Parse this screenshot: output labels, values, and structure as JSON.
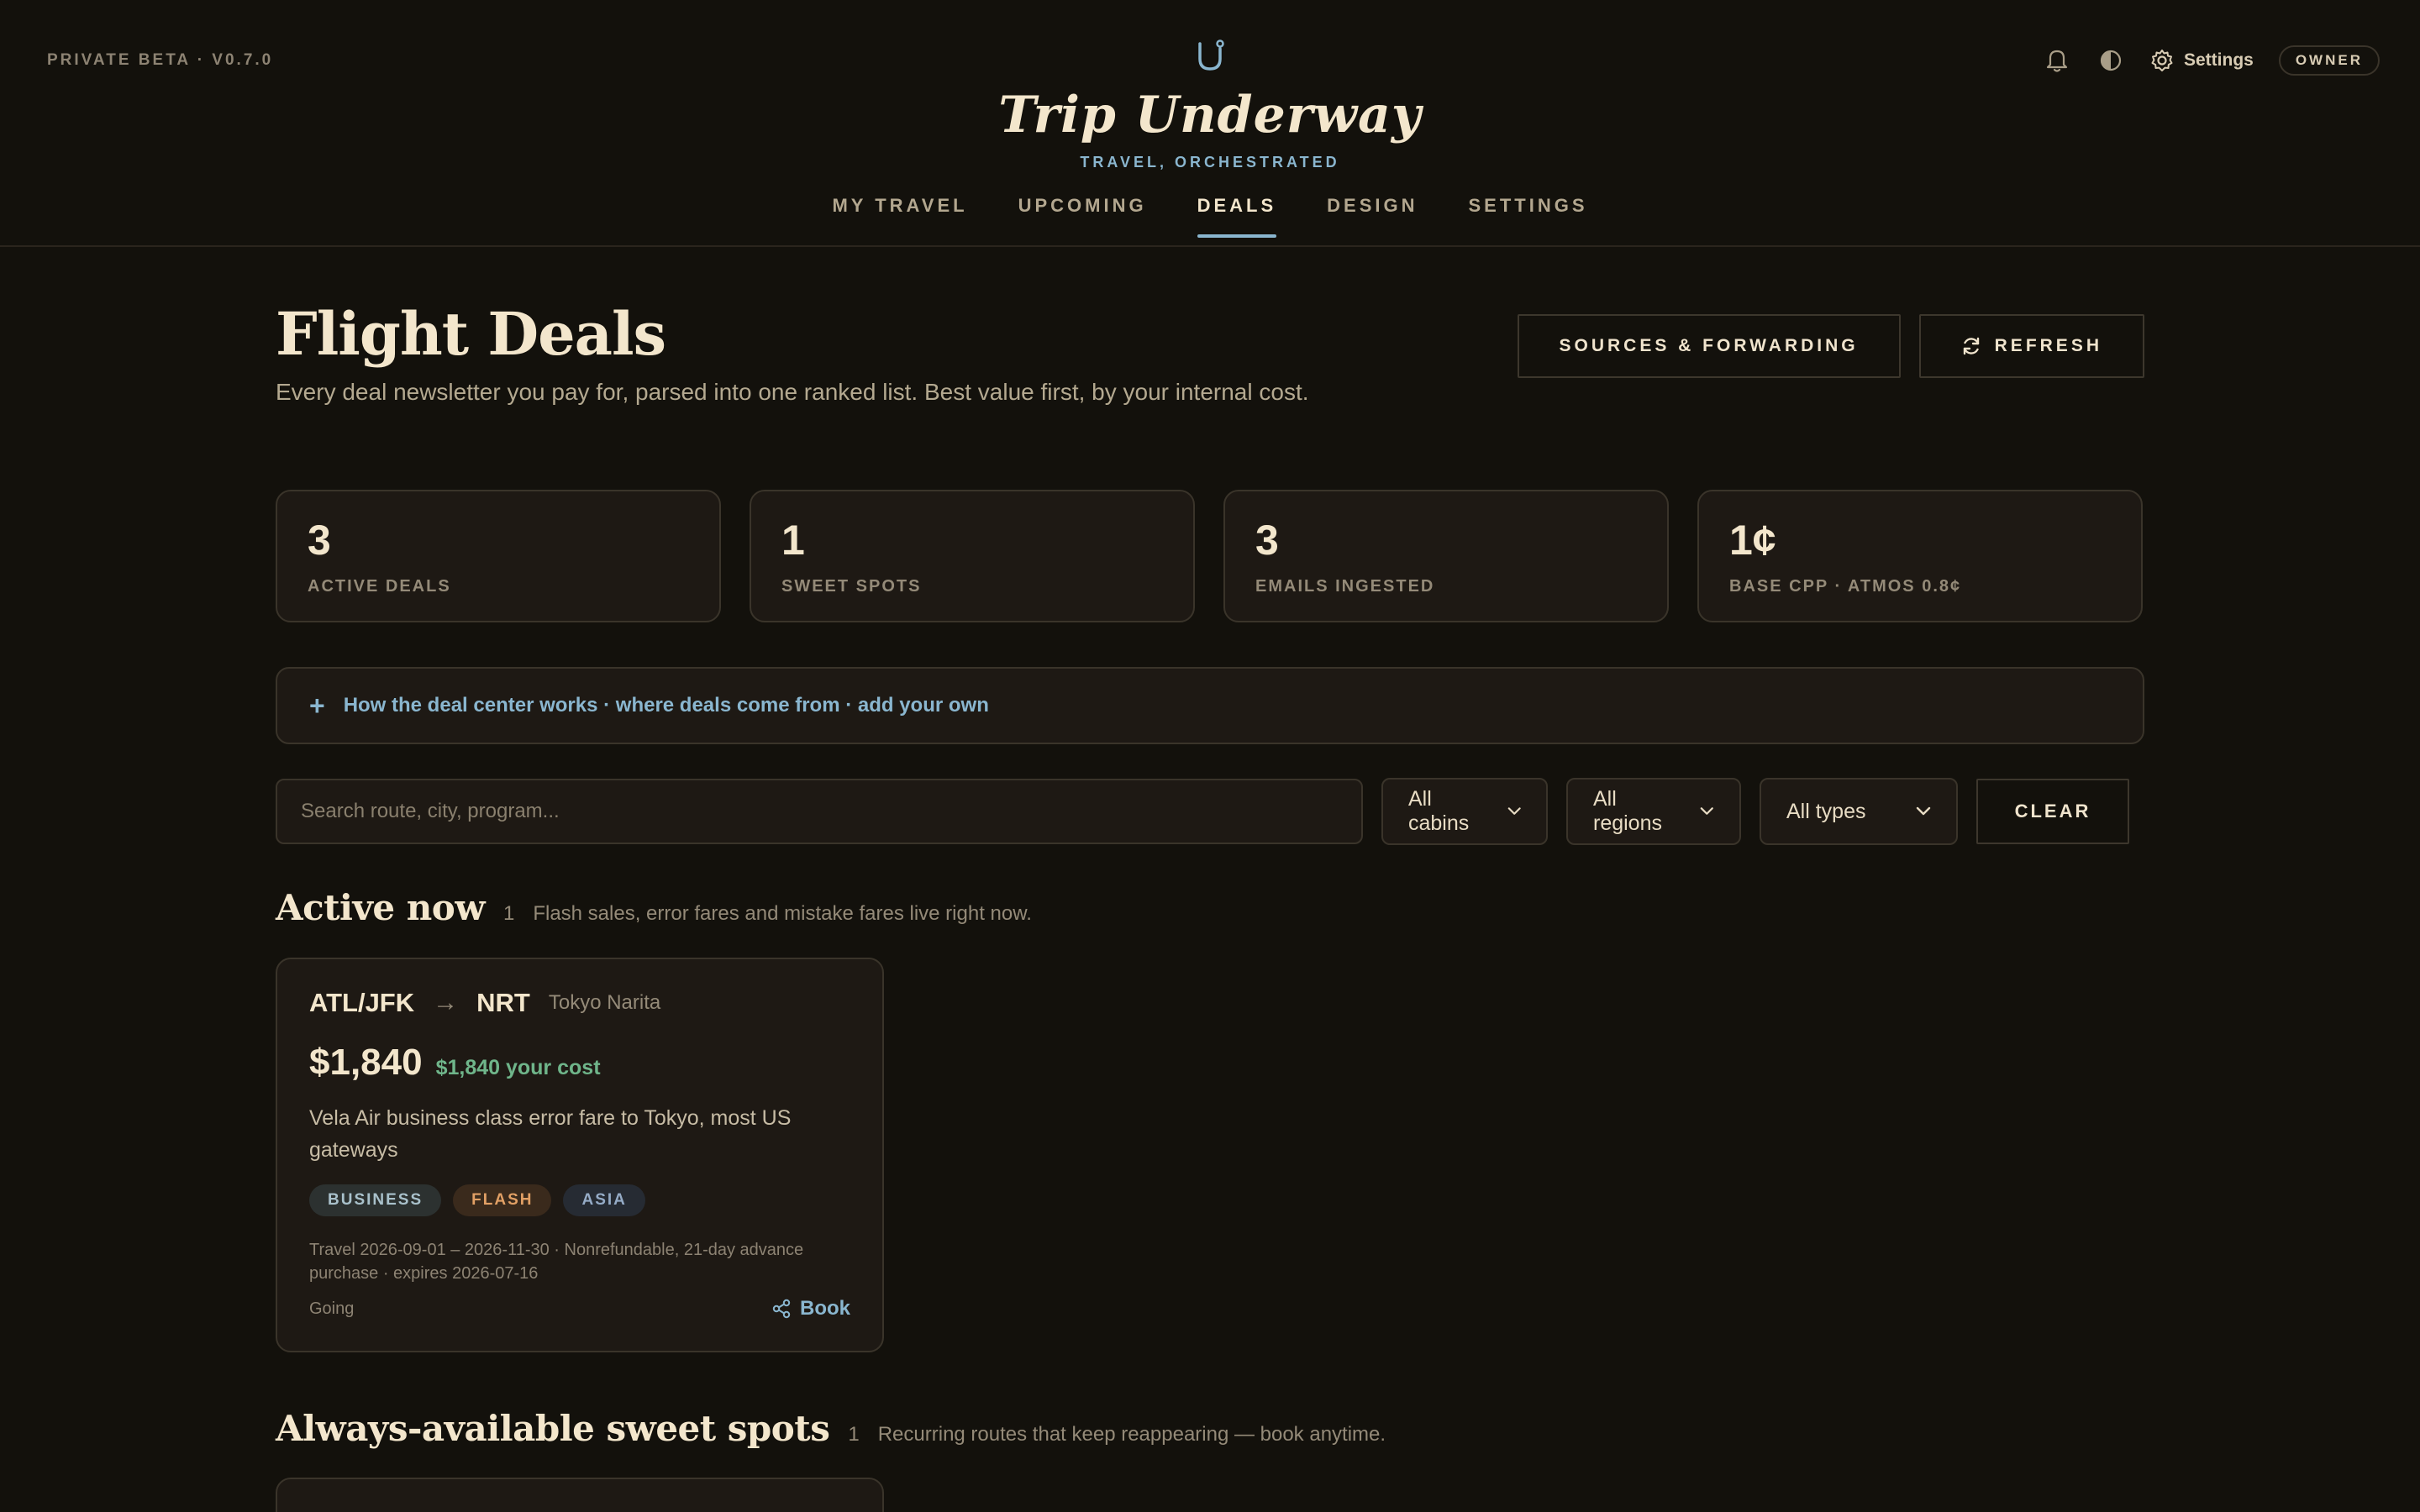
{
  "header": {
    "beta_label": "PRIVATE BETA · V0.7.0",
    "brand_title": "Trip Underway",
    "brand_subtitle": "TRAVEL, ORCHESTRATED",
    "settings_label": "Settings",
    "role_badge": "OWNER",
    "nav": [
      {
        "label": "MY TRAVEL",
        "active": false
      },
      {
        "label": "UPCOMING",
        "active": false
      },
      {
        "label": "DEALS",
        "active": true
      },
      {
        "label": "DESIGN",
        "active": false
      },
      {
        "label": "SETTINGS",
        "active": false
      }
    ]
  },
  "page": {
    "title": "Flight Deals",
    "description": "Every deal newsletter you pay for, parsed into one ranked list. Best value first, by your internal cost.",
    "sources_button": "SOURCES & FORWARDING",
    "refresh_button": "REFRESH"
  },
  "stats": [
    {
      "value": "3",
      "label": "ACTIVE DEALS"
    },
    {
      "value": "1",
      "label": "SWEET SPOTS"
    },
    {
      "value": "3",
      "label": "EMAILS INGESTED"
    },
    {
      "value": "1¢",
      "label": "BASE CPP · ATMOS 0.8¢"
    }
  ],
  "howto": {
    "icon": "plus-icon",
    "text": "How the deal center works · where deals come from · add your own"
  },
  "filters": {
    "search_placeholder": "Search route, city, program...",
    "cabins": "All cabins",
    "regions": "All regions",
    "types": "All types",
    "clear": "CLEAR"
  },
  "sections": {
    "active": {
      "title": "Active now",
      "count": "1",
      "desc": "Flash sales, error fares and mistake fares live right now."
    },
    "sweet": {
      "title": "Always-available sweet spots",
      "count": "1",
      "desc": "Recurring routes that keep reappearing — book anytime."
    }
  },
  "deal": {
    "from": "ATL/JFK",
    "to": "NRT",
    "city": "Tokyo Narita",
    "price": "$1,840",
    "your_cost": "$1,840 your cost",
    "description": "Vela Air business class error fare to Tokyo, most US gateways",
    "tags": [
      "BUSINESS",
      "FLASH",
      "ASIA"
    ],
    "meta": "Travel 2026-09-01 – 2026-11-30 · Nonrefundable, 21-day advance purchase · expires 2026-07-16",
    "status": "Going",
    "book_label": "Book"
  },
  "colors": {
    "background": "#13110c",
    "accent": "#8ab6cf",
    "positive": "#6fb58a",
    "flash": "#e2a065"
  }
}
